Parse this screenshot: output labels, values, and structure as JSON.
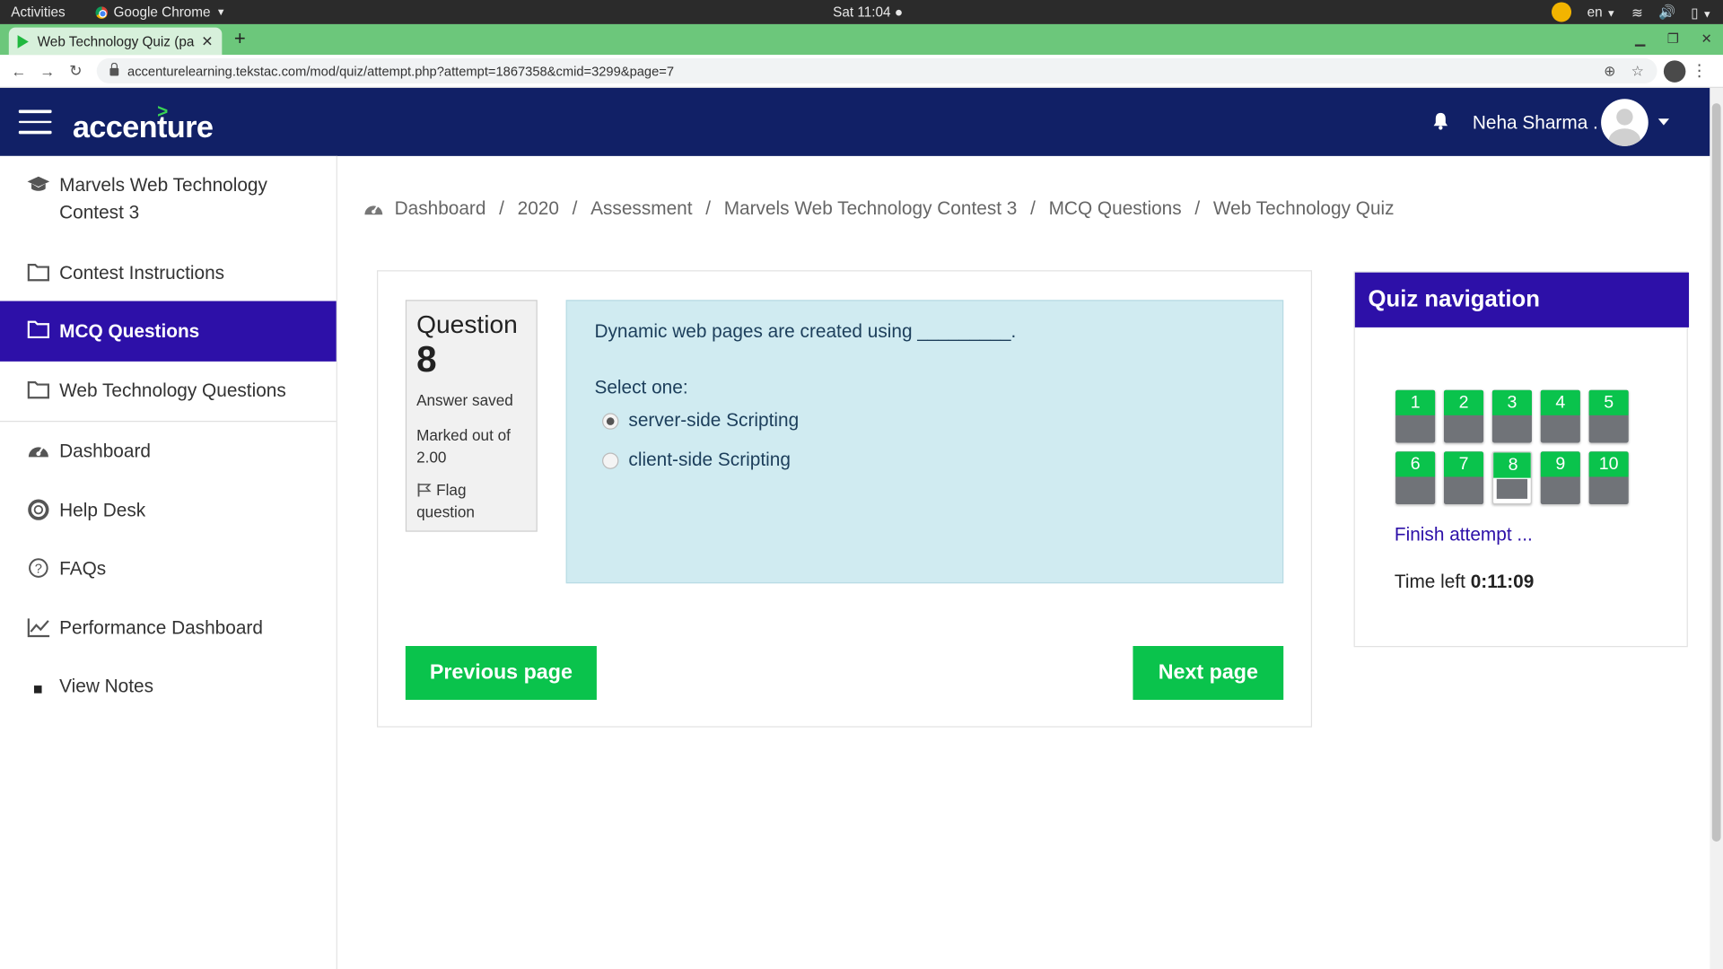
{
  "os": {
    "activities": "Activities",
    "app_name": "Google Chrome",
    "clock": "Sat 11:04",
    "lang": "en"
  },
  "browser": {
    "tab_title": "Web Technology Quiz (pa",
    "url": "accenturelearning.tekstac.com/mod/quiz/attempt.php?attempt=1867358&cmid=3299&page=7"
  },
  "header": {
    "brand": "accenture",
    "username": "Neha Sharma ."
  },
  "sidebar": {
    "items": [
      {
        "label": "Marvels Web Technology",
        "label2": "Contest 3",
        "icon": "graduation-cap-icon"
      },
      {
        "label": "Contest Instructions",
        "icon": "folder-icon"
      },
      {
        "label": "MCQ Questions",
        "icon": "folder-icon",
        "active": true
      },
      {
        "label": "Web Technology Questions",
        "icon": "folder-icon"
      },
      {
        "label": "Dashboard",
        "icon": "dashboard-icon"
      },
      {
        "label": "Help Desk",
        "icon": "lifebuoy-icon"
      },
      {
        "label": "FAQs",
        "icon": "question-circle-icon"
      },
      {
        "label": "Performance Dashboard",
        "icon": "line-chart-icon"
      },
      {
        "label": "View Notes",
        "icon": "square-bullet-icon"
      }
    ]
  },
  "breadcrumb": [
    "Dashboard",
    "2020",
    "Assessment",
    "Marvels Web Technology Contest 3",
    "MCQ Questions",
    "Web Technology Quiz"
  ],
  "question": {
    "heading": "Question",
    "number": "8",
    "state": "Answer saved",
    "marked_line1": "Marked out of",
    "marked_line2": "2.00",
    "flag_line1": "Flag",
    "flag_line2": "question",
    "text": "Dynamic web pages are created using _________.",
    "select_label": "Select one:",
    "options": [
      {
        "label": "server-side Scripting",
        "selected": true
      },
      {
        "label": "client-side Scripting",
        "selected": false
      }
    ]
  },
  "buttons": {
    "previous": "Previous page",
    "next": "Next page"
  },
  "quiz_nav": {
    "title": "Quiz navigation",
    "questions": [
      "1",
      "2",
      "3",
      "4",
      "5",
      "6",
      "7",
      "8",
      "9",
      "10"
    ],
    "current": "8",
    "finish_label": "Finish attempt ...",
    "time_left_label": "Time left",
    "time_left_value": "0:11:09"
  },
  "colors": {
    "header_bg": "#112066",
    "active_purple": "#2d10a8",
    "button_green": "#0ac34c",
    "question_bg": "#d0ebf1"
  }
}
